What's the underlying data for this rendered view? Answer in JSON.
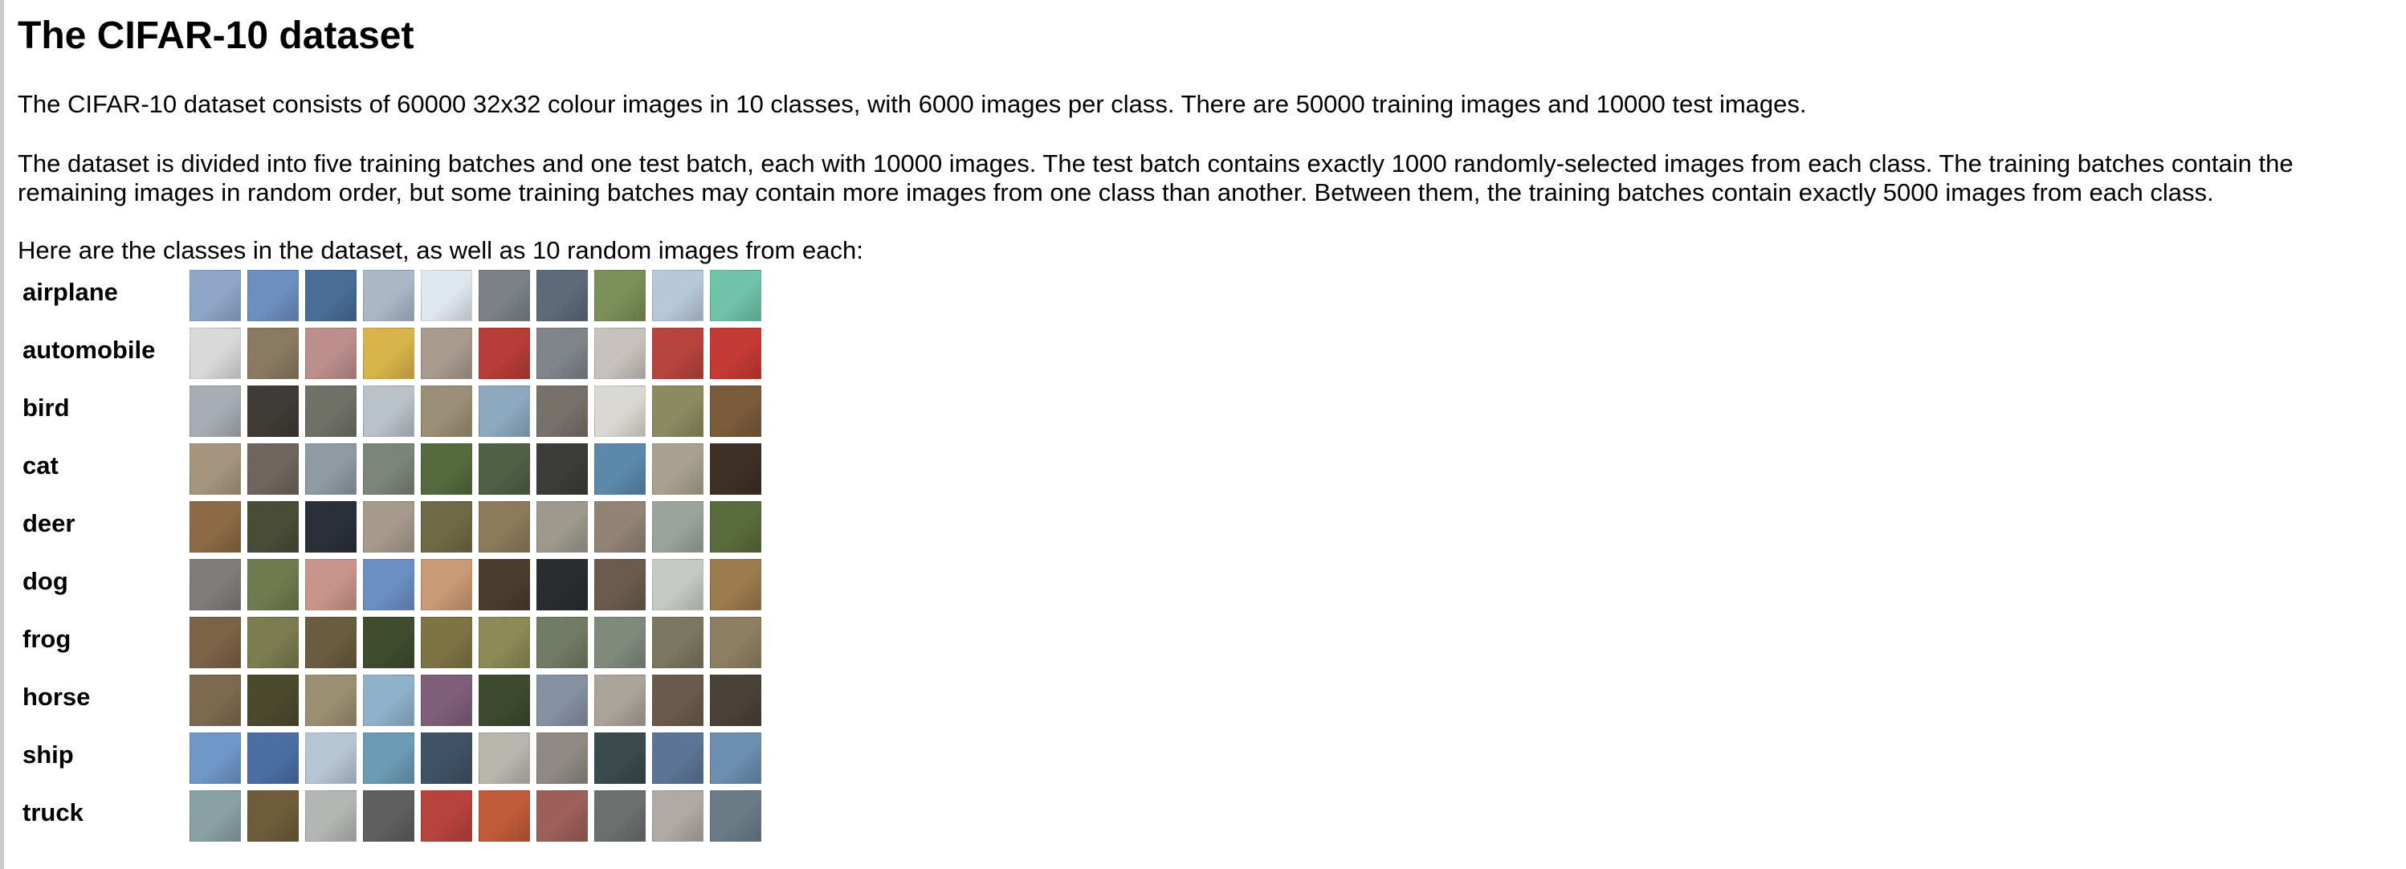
{
  "page": {
    "title": "The CIFAR-10 dataset",
    "paragraphs": [
      "The CIFAR-10 dataset consists of 60000 32x32 colour images in 10 classes, with 6000 images per class. There are 50000 training images and 10000 test images.",
      "The dataset is divided into five training batches and one test batch, each with 10000 images. The test batch contains exactly 1000 randomly-selected images from each class. The training batches contain the remaining images in random order, but some training batches may contain more images from one class than another. Between them, the training batches contain exactly 5000 images from each class.",
      "Here are the classes in the dataset, as well as 10 random images from each:"
    ]
  },
  "classes": [
    {
      "label": "airplane",
      "thumb_colors": [
        "#8fa6c8",
        "#6d8fc0",
        "#4a6d98",
        "#a9b7c7",
        "#dfe7ef",
        "#7c8188",
        "#5c6a7a",
        "#7b8f58",
        "#b7c8d8",
        "#6fc3a8"
      ]
    },
    {
      "label": "automobile",
      "thumb_colors": [
        "#d9d9d9",
        "#8a7a62",
        "#bb8f8c",
        "#d8b44a",
        "#a89b8e",
        "#b83c38",
        "#7f858b",
        "#c7c2be",
        "#b8443e",
        "#c63a34"
      ]
    },
    {
      "label": "bird",
      "thumb_colors": [
        "#a7adb4",
        "#3f3b36",
        "#6f7066",
        "#b9c1c9",
        "#9a8e76",
        "#8da9bf",
        "#77716a",
        "#dad8d2",
        "#8c8a61",
        "#7a5b3c"
      ]
    },
    {
      "label": "cat",
      "thumb_colors": [
        "#a6957e",
        "#6f655d",
        "#8f9aa3",
        "#7c857a",
        "#556b3e",
        "#4f6045",
        "#3c3c38",
        "#5b89ab",
        "#a9a18f",
        "#3f3025"
      ]
    },
    {
      "label": "deer",
      "thumb_colors": [
        "#8b6a45",
        "#4a4d36",
        "#2b2f3a",
        "#a69a8c",
        "#6f6a45",
        "#8c7a5a",
        "#9d9a8d",
        "#928376",
        "#9ca39c",
        "#5a6c3b"
      ]
    },
    {
      "label": "dog",
      "thumb_colors": [
        "#7f7d79",
        "#6f7b4e",
        "#c9958a",
        "#6b8fc3",
        "#c99a75",
        "#4a3d2e",
        "#2a2c30",
        "#6b5b4e",
        "#c7c9c6",
        "#9c7b4d"
      ]
    },
    {
      "label": "frog",
      "thumb_colors": [
        "#7c6246",
        "#7b7c50",
        "#6a5c3e",
        "#3f4c2e",
        "#7e7443",
        "#8c8a55",
        "#727b63",
        "#808a7c",
        "#7a765f",
        "#8f7f62"
      ]
    },
    {
      "label": "horse",
      "thumb_colors": [
        "#7d6a4e",
        "#4c4a2d",
        "#9a8f70",
        "#8fb2ca",
        "#7e5e78",
        "#3d4a2e",
        "#8590a2",
        "#a9a39a",
        "#6b5a4b",
        "#4a4238"
      ]
    },
    {
      "label": "ship",
      "thumb_colors": [
        "#6f97c8",
        "#4b6fa3",
        "#b6c5d4",
        "#6c9cb5",
        "#3f5266",
        "#b8b6ad",
        "#8e8a83",
        "#3a4a4d",
        "#5c7596",
        "#6c8eaf"
      ]
    },
    {
      "label": "truck",
      "thumb_colors": [
        "#8aa1a3",
        "#6f5c3b",
        "#b3b7b3",
        "#5f5f5f",
        "#b8433d",
        "#c05b3a",
        "#9c5f5a",
        "#6b6f6e",
        "#b0aaa4",
        "#6b7c87"
      ]
    }
  ]
}
